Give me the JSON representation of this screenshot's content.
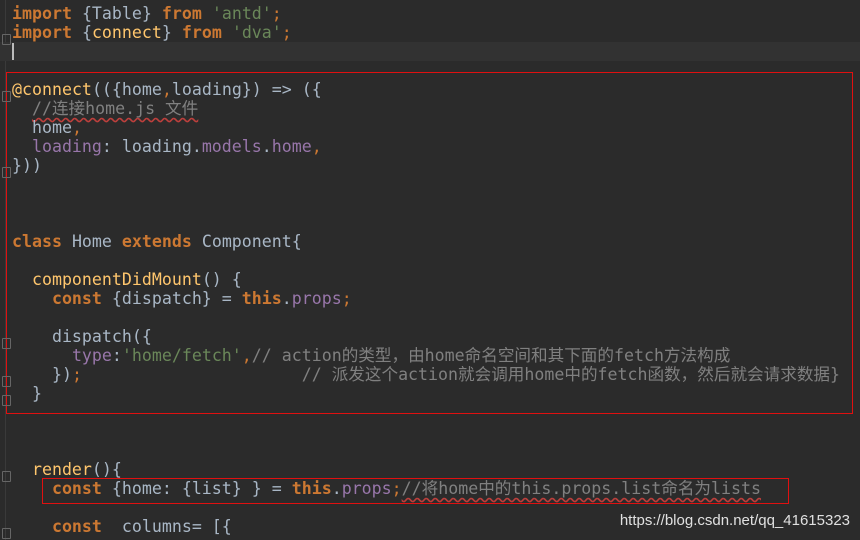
{
  "editor": {
    "lines": [
      {
        "row": 0,
        "indent": 0,
        "tokens": [
          {
            "t": "import",
            "c": "kw"
          },
          {
            "t": " {Table} ",
            "c": "pl"
          },
          {
            "t": "from",
            "c": "kw"
          },
          {
            "t": " ",
            "c": "pl"
          },
          {
            "t": "'antd'",
            "c": "str"
          },
          {
            "t": ";",
            "c": "punc"
          }
        ]
      },
      {
        "row": 1,
        "indent": 0,
        "tokens": [
          {
            "t": "import",
            "c": "kw"
          },
          {
            "t": " {",
            "c": "pl"
          },
          {
            "t": "connect",
            "c": "fn"
          },
          {
            "t": "} ",
            "c": "pl"
          },
          {
            "t": "from",
            "c": "kw"
          },
          {
            "t": " ",
            "c": "pl"
          },
          {
            "t": "'dva'",
            "c": "str"
          },
          {
            "t": ";",
            "c": "punc"
          }
        ]
      },
      {
        "row": 4,
        "indent": 0,
        "tokens": [
          {
            "t": "@connect",
            "c": "fn"
          },
          {
            "t": "(({home",
            "c": "pl"
          },
          {
            "t": ",",
            "c": "punc"
          },
          {
            "t": "loading}) => ({",
            "c": "pl"
          }
        ]
      },
      {
        "row": 5,
        "indent": 2,
        "tokens": [
          {
            "t": "//连接home.js 文件",
            "c": "cmu"
          }
        ]
      },
      {
        "row": 6,
        "indent": 2,
        "tokens": [
          {
            "t": "home",
            "c": "pl"
          },
          {
            "t": ",",
            "c": "punc"
          }
        ]
      },
      {
        "row": 7,
        "indent": 2,
        "tokens": [
          {
            "t": "loading",
            "c": "prop"
          },
          {
            "t": ": loading.",
            "c": "pl"
          },
          {
            "t": "models",
            "c": "prop"
          },
          {
            "t": ".",
            "c": "pl"
          },
          {
            "t": "home",
            "c": "prop"
          },
          {
            "t": ",",
            "c": "punc"
          }
        ]
      },
      {
        "row": 8,
        "indent": 0,
        "tokens": [
          {
            "t": "}))",
            "c": "pl"
          }
        ]
      },
      {
        "row": 12,
        "indent": 0,
        "tokens": [
          {
            "t": "class",
            "c": "kw"
          },
          {
            "t": " Home ",
            "c": "pl"
          },
          {
            "t": "extends",
            "c": "kw"
          },
          {
            "t": " Component{",
            "c": "pl"
          }
        ]
      },
      {
        "row": 14,
        "indent": 2,
        "tokens": [
          {
            "t": "componentDidMount",
            "c": "fn"
          },
          {
            "t": "() {",
            "c": "pl"
          }
        ]
      },
      {
        "row": 15,
        "indent": 4,
        "tokens": [
          {
            "t": "const",
            "c": "kw"
          },
          {
            "t": " {dispatch} = ",
            "c": "pl"
          },
          {
            "t": "this",
            "c": "kw"
          },
          {
            "t": ".",
            "c": "pl"
          },
          {
            "t": "props",
            "c": "prop"
          },
          {
            "t": ";",
            "c": "punc"
          }
        ]
      },
      {
        "row": 17,
        "indent": 4,
        "tokens": [
          {
            "t": "dispatch({",
            "c": "pl"
          }
        ]
      },
      {
        "row": 18,
        "indent": 6,
        "tokens": [
          {
            "t": "type",
            "c": "prop"
          },
          {
            "t": ":",
            "c": "pl"
          },
          {
            "t": "'home/fetch'",
            "c": "str"
          },
          {
            "t": ",",
            "c": "punc"
          },
          {
            "t": "// action的类型，由home命名空间和其下面的fetch方法构成",
            "c": "cm"
          }
        ]
      },
      {
        "row": 19,
        "indent": 4,
        "tokens": [
          {
            "t": "})",
            "c": "pl"
          },
          {
            "t": ";",
            "c": "punc"
          },
          {
            "t": "                      // 派发这个action就会调用home中的fetch函数，然后就会请求数据}",
            "c": "cm"
          }
        ]
      },
      {
        "row": 20,
        "indent": 2,
        "tokens": [
          {
            "t": "}",
            "c": "pl"
          }
        ]
      },
      {
        "row": 24,
        "indent": 2,
        "tokens": [
          {
            "t": "render",
            "c": "fn"
          },
          {
            "t": "(){",
            "c": "pl"
          }
        ]
      },
      {
        "row": 25,
        "indent": 4,
        "tokens": [
          {
            "t": "const",
            "c": "kw"
          },
          {
            "t": " {home: {list} } = ",
            "c": "pl"
          },
          {
            "t": "this",
            "c": "kw"
          },
          {
            "t": ".",
            "c": "pl"
          },
          {
            "t": "props",
            "c": "prop"
          },
          {
            "t": ";",
            "c": "punc"
          },
          {
            "t": "//将home中的this.props.list命名为lists",
            "c": "cmu"
          }
        ]
      },
      {
        "row": 27,
        "indent": 4,
        "tokens": [
          {
            "t": "const",
            "c": "kw"
          },
          {
            "t": "  columns= [{",
            "c": "pl"
          }
        ]
      }
    ],
    "current_line_row": 2,
    "watermark": "https://blog.csdn.net/qq_41615323"
  },
  "colors": {
    "background": "#2b2b2b",
    "keyword": "#cc7832",
    "string": "#6a8759",
    "property": "#9876aa",
    "function": "#ffc66d",
    "comment": "#808080",
    "annotation_box": "#e01010"
  }
}
